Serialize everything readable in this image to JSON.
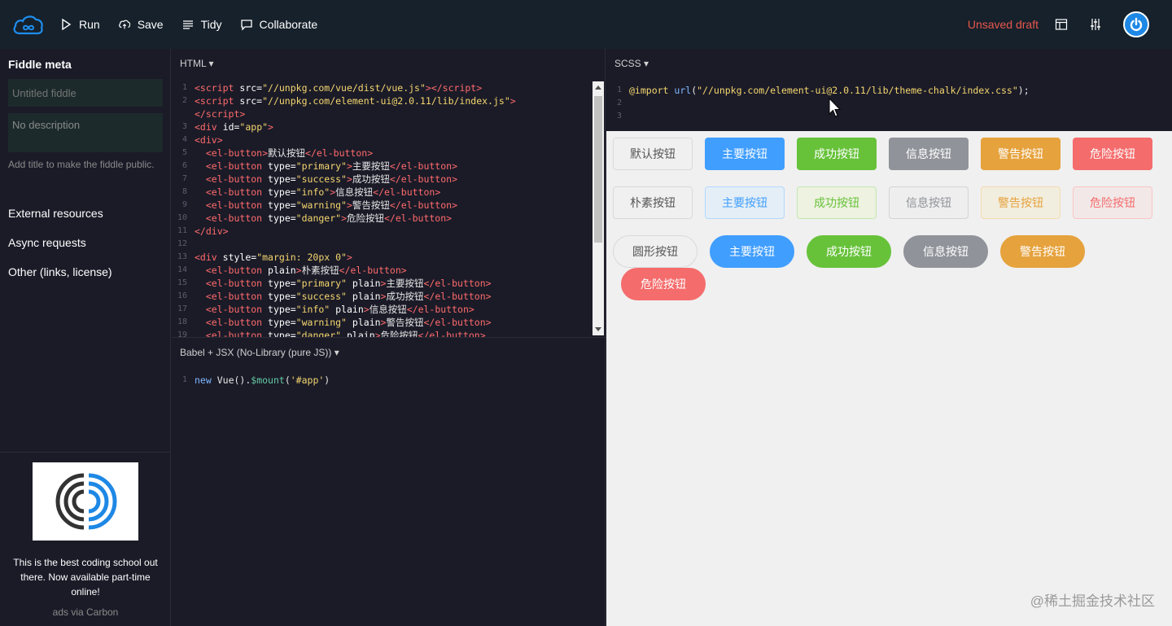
{
  "topbar": {
    "run_label": "Run",
    "save_label": "Save",
    "tidy_label": "Tidy",
    "collaborate_label": "Collaborate",
    "status": "Unsaved draft"
  },
  "sidebar": {
    "title": "Fiddle meta",
    "title_placeholder": "Untitled fiddle",
    "description_placeholder": "No description",
    "hint": "Add title to make the fiddle public.",
    "links": [
      "External resources",
      "Async requests",
      "Other (links, license)"
    ],
    "ad_text": "This is the best coding school out there. Now available part-time online!",
    "ad_via": "ads via Carbon"
  },
  "html_pane": {
    "title": "HTML ▾",
    "lines": [
      {
        "n": "1",
        "h": "<span class='t-tag'>&lt;script</span> <span class='t-attr'>src=</span><span class='t-str'>\"//unpkg.com/vue/dist/vue.js\"</span><span class='t-tag'>&gt;&lt;/script&gt;</span>"
      },
      {
        "n": "2",
        "h": "<span class='t-tag'>&lt;script</span> <span class='t-attr'>src=</span><span class='t-str'>\"//unpkg.com/element-ui@2.0.11/lib/index.js\"</span><span class='t-tag'>&gt;</span>"
      },
      {
        "n": "",
        "h": "<span class='t-tag'>&lt;/script&gt;</span>"
      },
      {
        "n": "3",
        "h": "<span class='t-tag'>&lt;div</span> <span class='t-attr'>id=</span><span class='t-str'>\"app\"</span><span class='t-tag'>&gt;</span>"
      },
      {
        "n": "4",
        "h": "<span class='t-tag'>&lt;div&gt;</span>"
      },
      {
        "n": "5",
        "h": "  <span class='t-tag'>&lt;el-button&gt;</span><span class='t-txt'>默认按钮</span><span class='t-tag'>&lt;/el-button&gt;</span>"
      },
      {
        "n": "6",
        "h": "  <span class='t-tag'>&lt;el-button</span> <span class='t-attr'>type=</span><span class='t-str'>\"primary\"</span><span class='t-tag'>&gt;</span><span class='t-txt'>主要按钮</span><span class='t-tag'>&lt;/el-button&gt;</span>"
      },
      {
        "n": "7",
        "h": "  <span class='t-tag'>&lt;el-button</span> <span class='t-attr'>type=</span><span class='t-str'>\"success\"</span><span class='t-tag'>&gt;</span><span class='t-txt'>成功按钮</span><span class='t-tag'>&lt;/el-button&gt;</span>"
      },
      {
        "n": "8",
        "h": "  <span class='t-tag'>&lt;el-button</span> <span class='t-attr'>type=</span><span class='t-str'>\"info\"</span><span class='t-tag'>&gt;</span><span class='t-txt'>信息按钮</span><span class='t-tag'>&lt;/el-button&gt;</span>"
      },
      {
        "n": "9",
        "h": "  <span class='t-tag'>&lt;el-button</span> <span class='t-attr'>type=</span><span class='t-str'>\"warning\"</span><span class='t-tag'>&gt;</span><span class='t-txt'>警告按钮</span><span class='t-tag'>&lt;/el-button&gt;</span>"
      },
      {
        "n": "10",
        "h": "  <span class='t-tag'>&lt;el-button</span> <span class='t-attr'>type=</span><span class='t-str'>\"danger\"</span><span class='t-tag'>&gt;</span><span class='t-txt'>危险按钮</span><span class='t-tag'>&lt;/el-button&gt;</span>"
      },
      {
        "n": "11",
        "h": "<span class='t-tag'>&lt;/div&gt;</span>"
      },
      {
        "n": "12",
        "h": ""
      },
      {
        "n": "13",
        "h": "<span class='t-tag'>&lt;div</span> <span class='t-attr'>style=</span><span class='t-str'>\"margin: 20px 0\"</span><span class='t-tag'>&gt;</span>"
      },
      {
        "n": "14",
        "h": "  <span class='t-tag'>&lt;el-button</span> <span class='t-attr'>plain</span><span class='t-tag'>&gt;</span><span class='t-txt'>朴素按钮</span><span class='t-tag'>&lt;/el-button&gt;</span>"
      },
      {
        "n": "15",
        "h": "  <span class='t-tag'>&lt;el-button</span> <span class='t-attr'>type=</span><span class='t-str'>\"primary\"</span> <span class='t-attr'>plain</span><span class='t-tag'>&gt;</span><span class='t-txt'>主要按钮</span><span class='t-tag'>&lt;/el-button&gt;</span>"
      },
      {
        "n": "16",
        "h": "  <span class='t-tag'>&lt;el-button</span> <span class='t-attr'>type=</span><span class='t-str'>\"success\"</span> <span class='t-attr'>plain</span><span class='t-tag'>&gt;</span><span class='t-txt'>成功按钮</span><span class='t-tag'>&lt;/el-button&gt;</span>"
      },
      {
        "n": "17",
        "h": "  <span class='t-tag'>&lt;el-button</span> <span class='t-attr'>type=</span><span class='t-str'>\"info\"</span> <span class='t-attr'>plain</span><span class='t-tag'>&gt;</span><span class='t-txt'>信息按钮</span><span class='t-tag'>&lt;/el-button&gt;</span>"
      },
      {
        "n": "18",
        "h": "  <span class='t-tag'>&lt;el-button</span> <span class='t-attr'>type=</span><span class='t-str'>\"warning\"</span> <span class='t-attr'>plain</span><span class='t-tag'>&gt;</span><span class='t-txt'>警告按钮</span><span class='t-tag'>&lt;/el-button&gt;</span>"
      },
      {
        "n": "19",
        "h": "  <span class='t-tag'>&lt;el-button</span> <span class='t-attr'>type=</span><span class='t-str'>\"danger\"</span> <span class='t-attr'>plain</span><span class='t-tag'>&gt;</span><span class='t-txt'>危险按钮</span><span class='t-tag'>&lt;/el-button&gt;</span>"
      }
    ]
  },
  "js_pane": {
    "title": "Babel + JSX (No-Library (pure JS)) ▾",
    "lines": [
      {
        "n": "1",
        "h": "<span class='t-kw'>new</span> <span class='t-txt'>Vue().</span><span class='t-fn'>$mount</span><span class='t-txt'>(</span><span class='t-str'>'#app'</span><span class='t-txt'>)</span>"
      }
    ]
  },
  "scss_pane": {
    "title": "SCSS ▾",
    "lines": [
      {
        "n": "1",
        "h": "<span class='t-str'>@import</span> <span class='t-kw'>url</span><span class='t-txt'>(</span><span class='t-str'>\"//unpkg.com/element-ui@2.0.11/lib/theme-chalk/index.css\"</span><span class='t-txt'>);</span>"
      },
      {
        "n": "2",
        "h": ""
      },
      {
        "n": "3",
        "h": ""
      }
    ]
  },
  "result": {
    "row1": [
      {
        "label": "默认按钮",
        "bg": "#f0f0f0",
        "color": "#555555",
        "border": "#d9d9d9"
      },
      {
        "label": "主要按钮",
        "bg": "#409eff",
        "color": "#ffffff",
        "border": "#409eff"
      },
      {
        "label": "成功按钮",
        "bg": "#67c23a",
        "color": "#ffffff",
        "border": "#67c23a"
      },
      {
        "label": "信息按钮",
        "bg": "#909399",
        "color": "#ffffff",
        "border": "#909399"
      },
      {
        "label": "警告按钮",
        "bg": "#e6a23c",
        "color": "#ffffff",
        "border": "#e6a23c"
      },
      {
        "label": "危险按钮",
        "bg": "#f56c6c",
        "color": "#ffffff",
        "border": "#f56c6c"
      }
    ],
    "row2": [
      {
        "label": "朴素按钮",
        "bg": "#f0f0f0",
        "color": "#555555",
        "border": "#d9d9d9"
      },
      {
        "label": "主要按钮",
        "bg": "#e3eef6",
        "color": "#409eff",
        "border": "#b3d8ff"
      },
      {
        "label": "成功按钮",
        "bg": "#eef2e0",
        "color": "#67c23a",
        "border": "#c2e7b0"
      },
      {
        "label": "信息按钮",
        "bg": "#eeeeee",
        "color": "#909399",
        "border": "#d3d4d6"
      },
      {
        "label": "警告按钮",
        "bg": "#f2eedf",
        "color": "#e6a23c",
        "border": "#f5dab1"
      },
      {
        "label": "危险按钮",
        "bg": "#f2e8e8",
        "color": "#f56c6c",
        "border": "#fbc4c4"
      }
    ],
    "row3": [
      {
        "label": "圆形按钮",
        "bg": "#f0f0f0",
        "color": "#555555",
        "border": "#d9d9d9"
      },
      {
        "label": "主要按钮",
        "bg": "#409eff",
        "color": "#ffffff",
        "border": "#409eff"
      },
      {
        "label": "成功按钮",
        "bg": "#67c23a",
        "color": "#ffffff",
        "border": "#67c23a"
      },
      {
        "label": "信息按钮",
        "bg": "#909399",
        "color": "#ffffff",
        "border": "#909399"
      },
      {
        "label": "警告按钮",
        "bg": "#e6a23c",
        "color": "#ffffff",
        "border": "#e6a23c"
      }
    ],
    "row4": [
      {
        "label": "危险按钮",
        "bg": "#f56c6c",
        "color": "#ffffff",
        "border": "#f56c6c"
      }
    ],
    "watermark": "@稀土掘金技术社区"
  }
}
